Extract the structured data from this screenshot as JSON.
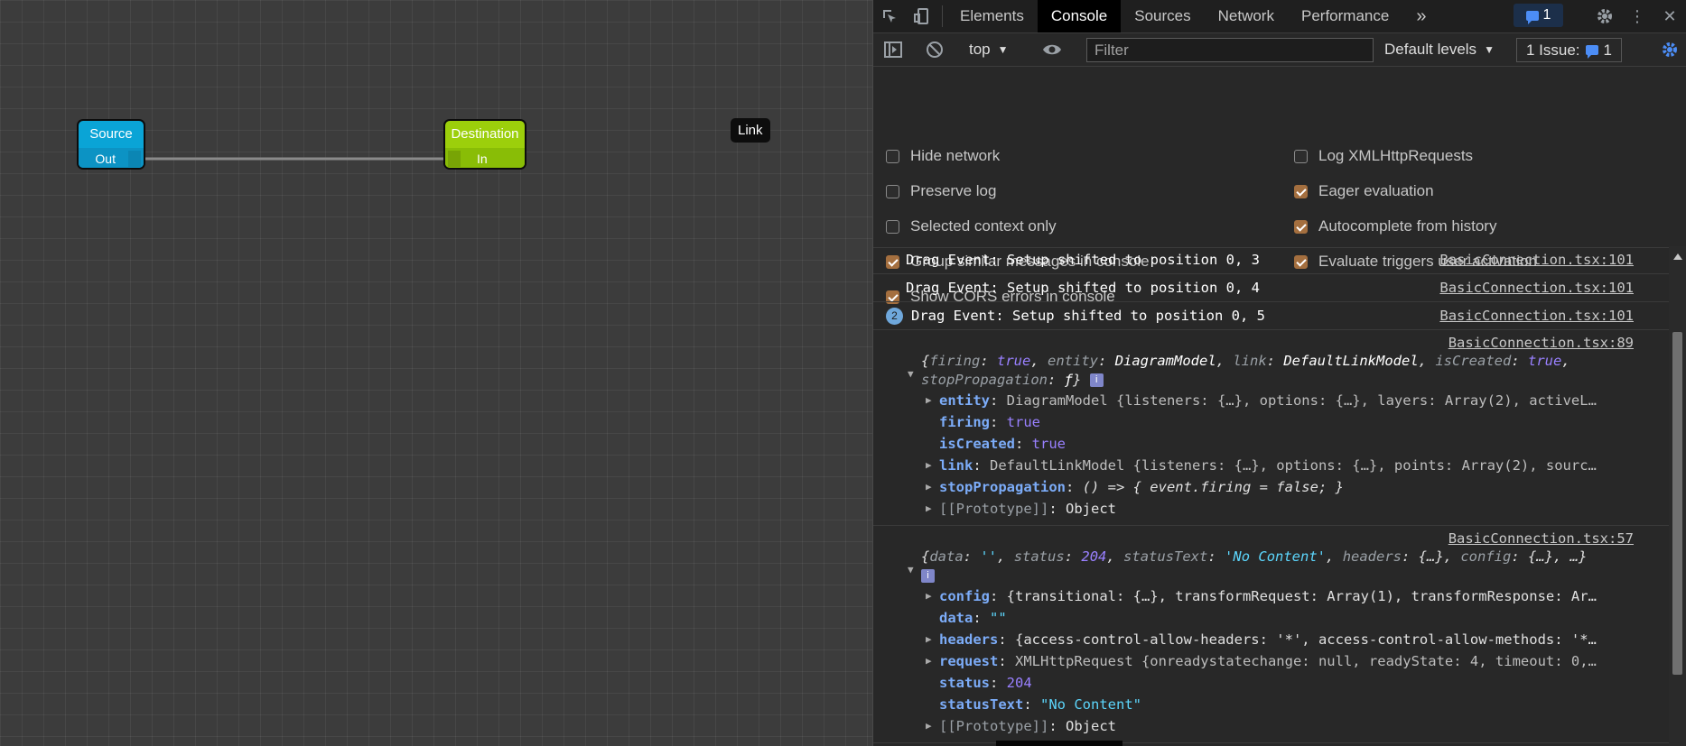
{
  "canvas": {
    "source_node": {
      "title": "Source",
      "port": "Out",
      "color": "#0aa4d6"
    },
    "destination_node": {
      "title": "Destination",
      "port": "In",
      "color": "#9ccf0b"
    },
    "link_label": "Link"
  },
  "devtools": {
    "tabs": [
      "Elements",
      "Console",
      "Sources",
      "Network",
      "Performance"
    ],
    "active_tab": "Console",
    "issues_badge_count": "1",
    "toolbar": {
      "context": "top",
      "filter_placeholder": "Filter",
      "levels": "Default levels",
      "issues_label": "1 Issue:",
      "issues_count": "1"
    },
    "settings": {
      "left": [
        {
          "label": "Hide network",
          "checked": false
        },
        {
          "label": "Preserve log",
          "checked": false
        },
        {
          "label": "Selected context only",
          "checked": false
        },
        {
          "label": "Group similar messages in console",
          "checked": true
        },
        {
          "label": "Show CORS errors in console",
          "checked": true
        }
      ],
      "right": [
        {
          "label": "Log XMLHttpRequests",
          "checked": false
        },
        {
          "label": "Eager evaluation",
          "checked": true
        },
        {
          "label": "Autocomplete from history",
          "checked": true
        },
        {
          "label": "Evaluate triggers user activation",
          "checked": true
        }
      ]
    },
    "console": {
      "messages": [
        {
          "text": "Drag Event: Setup shifted to position 0, 3",
          "source": "BasicConnection.tsx:101"
        },
        {
          "text": "Drag Event: Setup shifted to position 0, 4",
          "source": "BasicConnection.tsx:101"
        },
        {
          "text": "Drag Event: Setup shifted to position 0, 5",
          "source": "BasicConnection.tsx:101",
          "count": "2"
        }
      ],
      "object1": {
        "source": "BasicConnection.tsx:89",
        "props": {
          "entity_key": "entity",
          "entity_val": "DiagramModel {listeners: {…}, options: {…}, layers: Array(2), activeL…",
          "firing_key": "firing",
          "firing_val": "true",
          "isCreated_key": "isCreated",
          "isCreated_val": "true",
          "link_key": "link",
          "link_val": "DefaultLinkModel {listeners: {…}, options: {…}, points: Array(2), sourc…",
          "stop_key": "stopPropagation",
          "stop_val": "() => { event.firing = false; }",
          "proto_key": "[[Prototype]]",
          "proto_val": "Object"
        }
      },
      "object2": {
        "source": "BasicConnection.tsx:57",
        "props": {
          "config_key": "config",
          "config_val": "{transitional: {…}, transformRequest: Array(1), transformResponse: Ar…",
          "data_key": "data",
          "data_val": "\"\"",
          "headers_key": "headers",
          "headers_val": "{access-control-allow-headers: '*', access-control-allow-methods: '*…",
          "request_key": "request",
          "request_val": "XMLHttpRequest {onreadystatechange: null, readyState: 4, timeout: 0,…",
          "status_key": "status",
          "status_val": "204",
          "statusText_key": "statusText",
          "statusText_val": "\"No Content\"",
          "proto_key": "[[Prototype]]",
          "proto_val": "Object"
        }
      }
    }
  }
}
